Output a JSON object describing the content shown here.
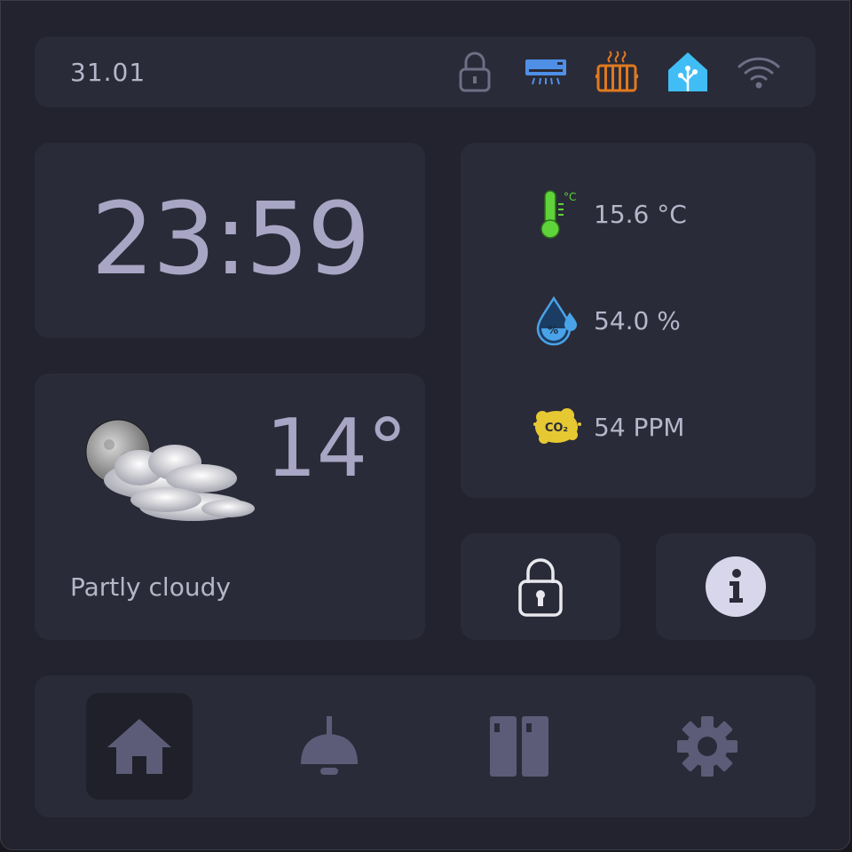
{
  "header": {
    "date": "31.01",
    "status_icons": [
      "lock-icon",
      "air-conditioner-icon",
      "radiator-icon",
      "home-assistant-icon",
      "wifi-icon"
    ]
  },
  "clock": {
    "time": "23:59"
  },
  "sensors": {
    "temperature": "15.6 °C",
    "humidity": "54.0 %",
    "co2": "54 PPM",
    "co2_icon_text": "CO₂"
  },
  "weather": {
    "temperature": "14°",
    "condition": "Partly cloudy",
    "icon": "night-partly-cloudy-icon"
  },
  "buttons": {
    "lock": "lock-icon",
    "info": "info-icon"
  },
  "nav": {
    "items": [
      "home-icon",
      "ceiling-lamp-icon",
      "doors-icon",
      "gear-icon"
    ],
    "active": "home"
  },
  "colors": {
    "background": "#22232e",
    "card": "#2a2b38",
    "text": "#b6b5c9",
    "big_text": "#a8a6c4",
    "ac_blue": "#4f8fe6",
    "radiator_orange": "#e07a1f",
    "ha_blue": "#41bdf5",
    "thermo_green": "#5fd33a",
    "humidity_blue": "#4aa3e8",
    "co2_yellow": "#e6c832",
    "nav_icon": "#5d5c78"
  }
}
